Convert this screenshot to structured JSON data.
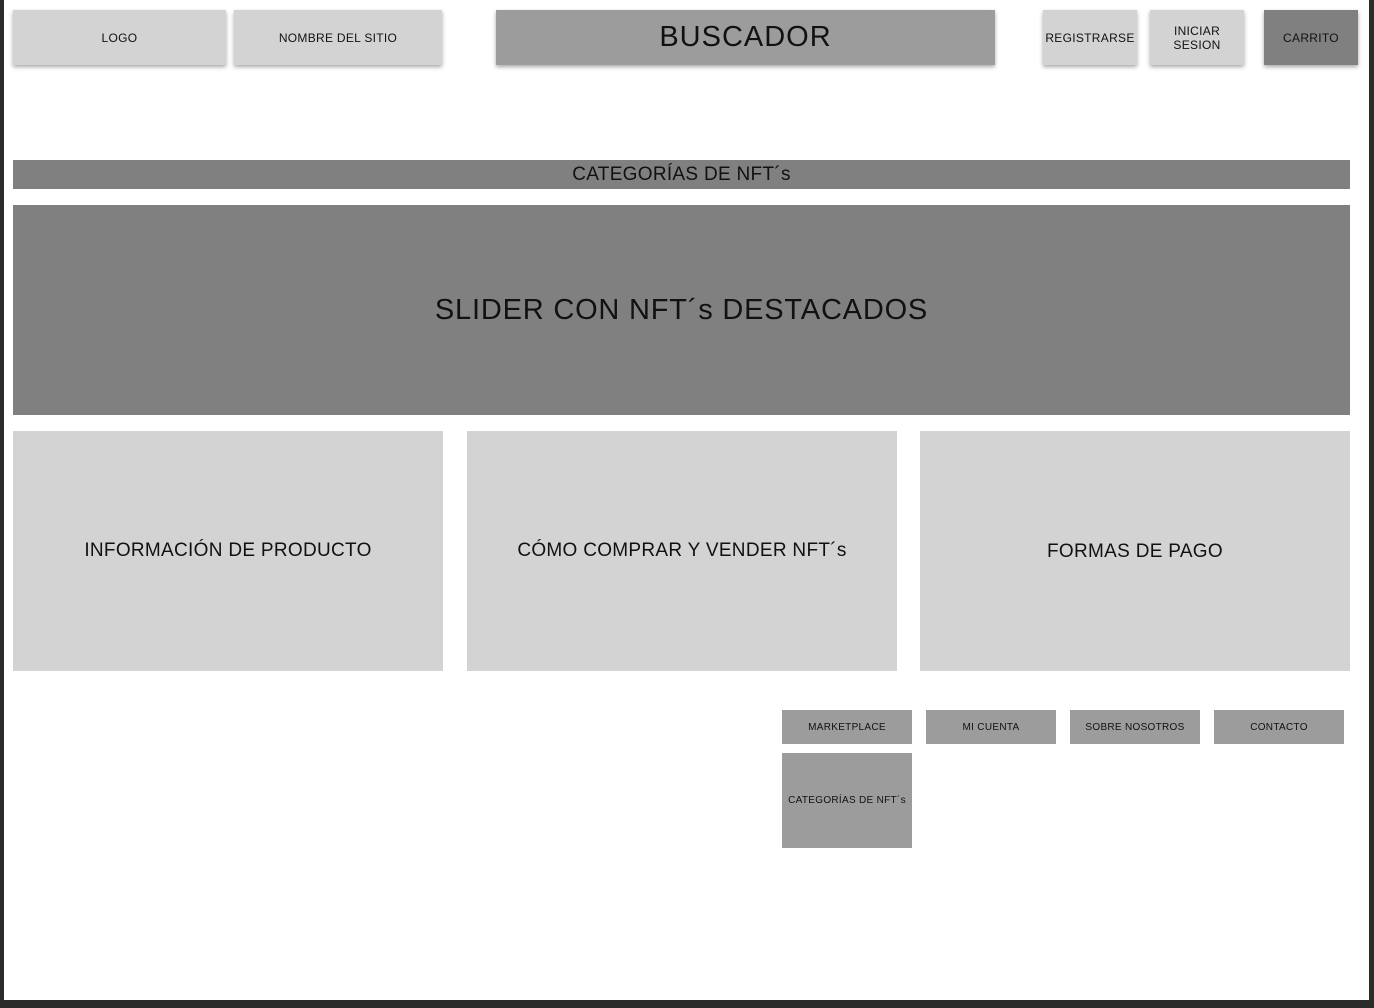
{
  "header": {
    "logo": "LOGO",
    "site_name": "NOMBRE DEL SITIO",
    "search": "BUSCADOR",
    "register": "REGISTRARSE",
    "login": "INICIAR SESION",
    "cart": "CARRITO"
  },
  "categories_bar": "CATEGORÍAS DE NFT´s",
  "slider": "SLIDER CON NFT´s DESTACADOS",
  "panels": [
    "INFORMACIÓN DE PRODUCTO",
    "CÓMO COMPRAR Y VENDER NFT´s",
    "FORMAS DE PAGO"
  ],
  "footer_nav": {
    "marketplace": "MARKETPLACE",
    "my_account": "MI CUENTA",
    "about": "SOBRE NOSOTROS",
    "contact": "CONTACTO",
    "categories": "CATEGORÍAS DE NFT´s"
  },
  "colors": {
    "light_gray": "#d3d3d3",
    "mid_gray": "#9c9c9c",
    "dark_gray": "#808080",
    "frame": "#2b2b2b"
  }
}
